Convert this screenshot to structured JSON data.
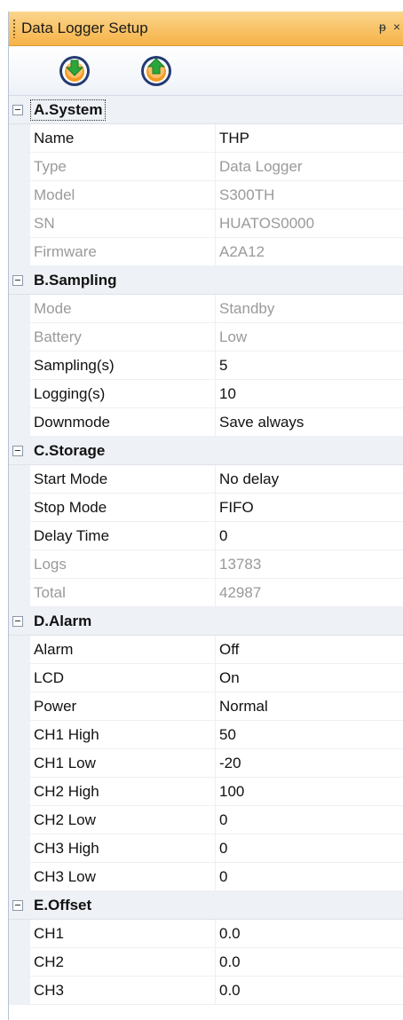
{
  "window": {
    "title": "Data Logger Setup",
    "pin_glyph": "ᵽ",
    "close_glyph": "×"
  },
  "toolbar": [
    {
      "name": "download-icon",
      "direction": "down",
      "color": "#2aa63a"
    },
    {
      "name": "upload-icon",
      "direction": "up",
      "color": "#2aa63a"
    }
  ],
  "categories": [
    {
      "label": "A.System",
      "rows": [
        {
          "name": "Name",
          "value": "THP",
          "readonly": false
        },
        {
          "name": "Type",
          "value": "Data Logger",
          "readonly": true
        },
        {
          "name": "Model",
          "value": "S300TH",
          "readonly": true
        },
        {
          "name": "SN",
          "value": "HUATOS0000",
          "readonly": true
        },
        {
          "name": "Firmware",
          "value": "A2A12",
          "readonly": true
        }
      ]
    },
    {
      "label": "B.Sampling",
      "rows": [
        {
          "name": "Mode",
          "value": "Standby",
          "readonly": true
        },
        {
          "name": "Battery",
          "value": "Low",
          "readonly": true
        },
        {
          "name": "Sampling(s)",
          "value": "5",
          "readonly": false
        },
        {
          "name": "Logging(s)",
          "value": "10",
          "readonly": false
        },
        {
          "name": "Downmode",
          "value": "Save always",
          "readonly": false
        }
      ]
    },
    {
      "label": "C.Storage",
      "rows": [
        {
          "name": "Start Mode",
          "value": "No delay",
          "readonly": false
        },
        {
          "name": "Stop Mode",
          "value": "FIFO",
          "readonly": false
        },
        {
          "name": "Delay Time",
          "value": "0",
          "readonly": false
        },
        {
          "name": "Logs",
          "value": "13783",
          "readonly": true
        },
        {
          "name": "Total",
          "value": "42987",
          "readonly": true
        }
      ]
    },
    {
      "label": "D.Alarm",
      "rows": [
        {
          "name": "Alarm",
          "value": "Off",
          "readonly": false
        },
        {
          "name": "LCD",
          "value": "On",
          "readonly": false
        },
        {
          "name": "Power",
          "value": "Normal",
          "readonly": false
        },
        {
          "name": "CH1 High",
          "value": "50",
          "readonly": false
        },
        {
          "name": "CH1 Low",
          "value": "-20",
          "readonly": false
        },
        {
          "name": "CH2 High",
          "value": "100",
          "readonly": false
        },
        {
          "name": "CH2 Low",
          "value": "0",
          "readonly": false
        },
        {
          "name": "CH3 High",
          "value": "0",
          "readonly": false
        },
        {
          "name": "CH3 Low",
          "value": "0",
          "readonly": false
        }
      ]
    },
    {
      "label": "E.Offset",
      "rows": [
        {
          "name": "CH1",
          "value": "0.0",
          "readonly": false
        },
        {
          "name": "CH2",
          "value": "0.0",
          "readonly": false
        },
        {
          "name": "CH3",
          "value": "0.0",
          "readonly": false
        }
      ]
    }
  ]
}
